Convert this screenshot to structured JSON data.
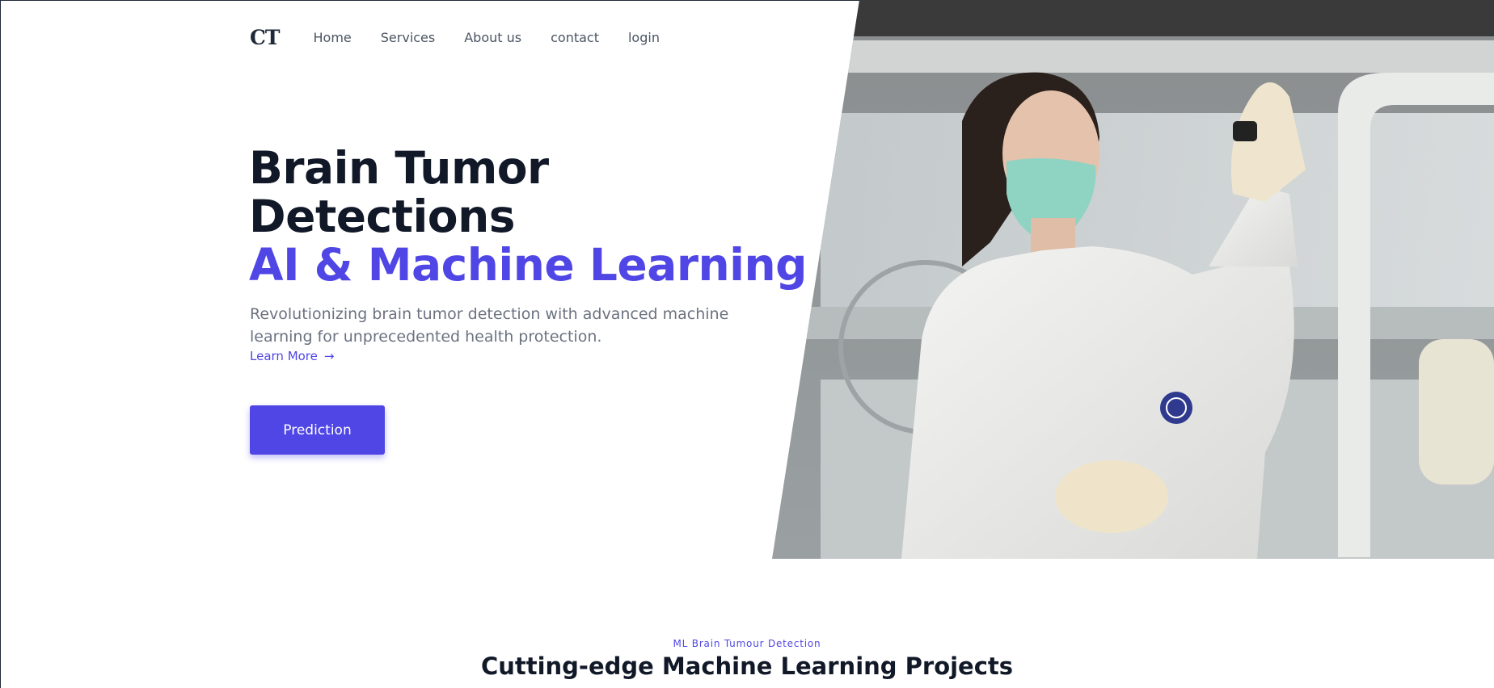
{
  "nav": {
    "logo": "CT",
    "items": [
      "Home",
      "Services",
      "About us",
      "contact",
      "login"
    ]
  },
  "hero": {
    "title_line1": "Brain Tumor",
    "title_line2": "Detections",
    "title_accent": "AI & Machine Learning",
    "description": "Revolutionizing brain tumor detection with advanced machine learning for unprecedented health protection.",
    "learn_more": "Learn More",
    "learn_more_icon": "arrow-right-icon",
    "button": "Prediction",
    "image_subject": "doctor-in-lab-coat-holding-slide"
  },
  "section": {
    "eyebrow": "ML Brain Tumour Detection",
    "title": "Cutting-edge Machine Learning Projects"
  },
  "colors": {
    "accent": "#4f46e5",
    "heading": "#111827",
    "body_text": "#6b7280",
    "nav_text": "#4b5563"
  }
}
